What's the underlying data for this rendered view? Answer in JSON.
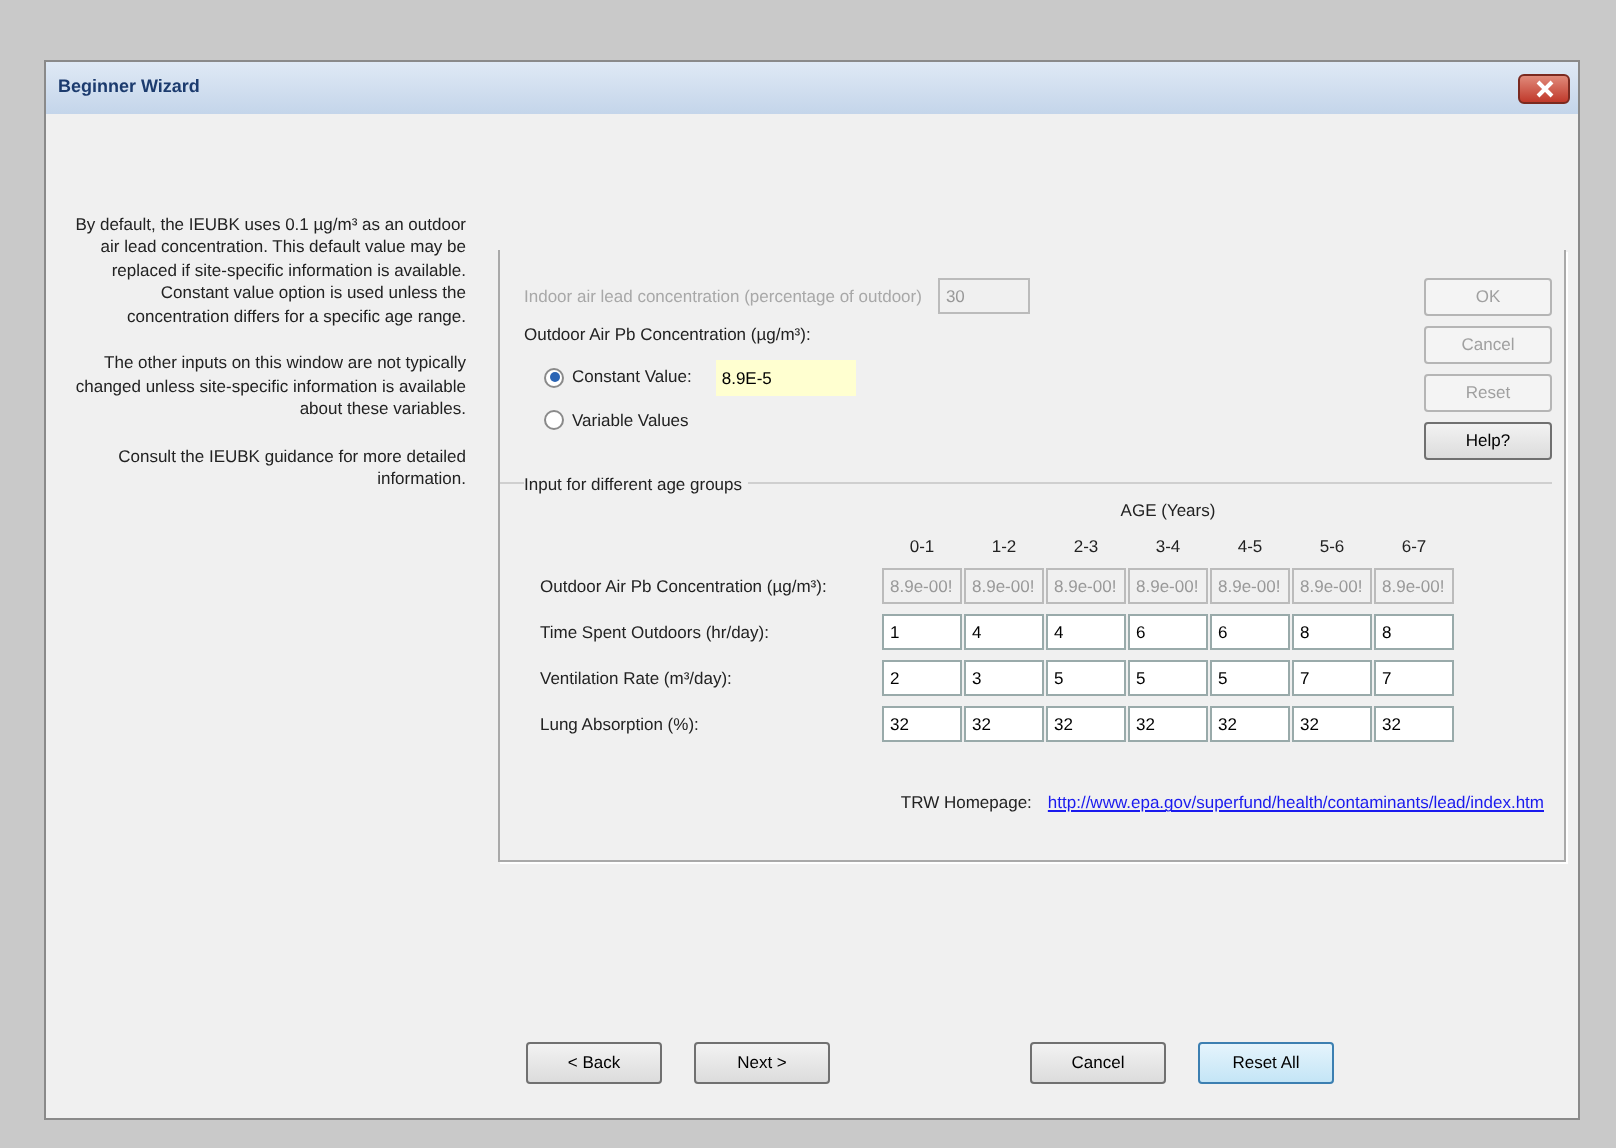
{
  "window": {
    "title": "Beginner Wizard"
  },
  "help_text": [
    "By default, the IEUBK uses 0.1 µg/m³ as an outdoor air lead concentration. This default value may be replaced if site-specific information is available. Constant value option is used unless the concentration differs for a specific age range.",
    "The other inputs on this window are not typically changed unless site-specific information is available about these variables.",
    "Consult the IEUBK guidance for more detailed information."
  ],
  "indoor": {
    "label": "Indoor air lead concentration (percentage of outdoor)",
    "value": "30",
    "disabled": true
  },
  "outdoor_label": "Outdoor Air Pb Concentration (µg/m³):",
  "radios": [
    {
      "label": "Constant Value:",
      "selected": true
    },
    {
      "label": "Variable Values",
      "selected": false
    }
  ],
  "constant_value": "8.9E-5",
  "side_buttons": [
    {
      "label": "OK",
      "disabled": true
    },
    {
      "label": "Cancel",
      "disabled": true
    },
    {
      "label": "Reset",
      "disabled": true
    },
    {
      "label": "Help?",
      "disabled": false
    }
  ],
  "age_group": {
    "title": "Input for different age groups",
    "header": "AGE (Years)",
    "columns": [
      "0-1",
      "1-2",
      "2-3",
      "3-4",
      "4-5",
      "5-6",
      "6-7"
    ],
    "rows": [
      {
        "label": "Outdoor Air Pb Concentration (µg/m³):",
        "disabled": true,
        "cells": [
          "8.9e-00!",
          "8.9e-00!",
          "8.9e-00!",
          "8.9e-00!",
          "8.9e-00!",
          "8.9e-00!",
          "8.9e-00!"
        ]
      },
      {
        "label": "Time Spent Outdoors (hr/day):",
        "disabled": false,
        "cells": [
          "1",
          "4",
          "4",
          "6",
          "6",
          "8",
          "8"
        ]
      },
      {
        "label": "Ventilation Rate (m³/day):",
        "disabled": false,
        "cells": [
          "2",
          "3",
          "5",
          "5",
          "5",
          "7",
          "7"
        ]
      },
      {
        "label": "Lung Absorption (%):",
        "disabled": false,
        "cells": [
          "32",
          "32",
          "32",
          "32",
          "32",
          "32",
          "32"
        ]
      }
    ]
  },
  "homepage": {
    "label": "TRW Homepage:",
    "url": "http://www.epa.gov/superfund/health/contaminants/lead/index.htm"
  },
  "nav_buttons": [
    {
      "label": "< Back",
      "default": false
    },
    {
      "label": "Next >",
      "default": false
    },
    {
      "label": "Cancel",
      "default": false
    },
    {
      "label": "Reset All",
      "default": true
    }
  ]
}
